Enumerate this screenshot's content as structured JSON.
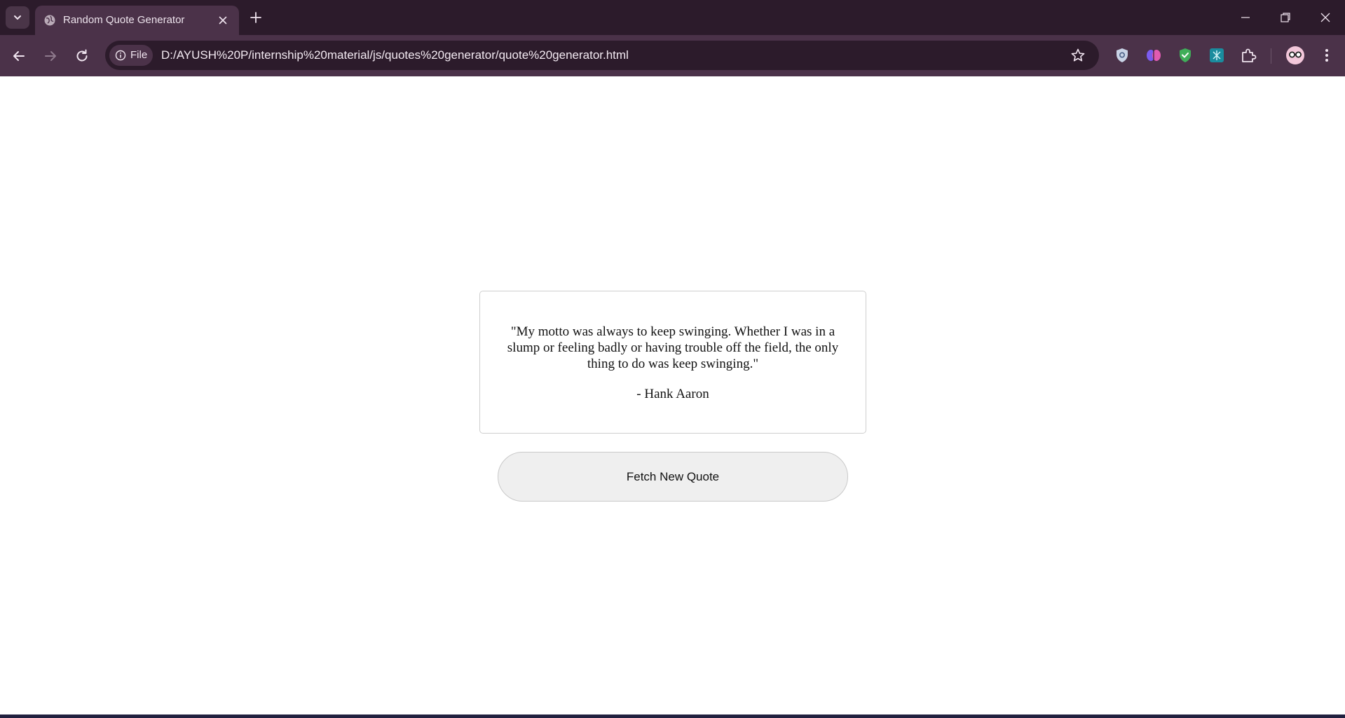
{
  "browser": {
    "tab_title": "Random Quote Generator",
    "site_chip_label": "File",
    "url": "D:/AYUSH%20P/internship%20material/js/quotes%20generator/quote%20generator.html",
    "accent_color": "#4b3249",
    "frame_color": "#2c1b2b"
  },
  "icons": {
    "tab_search": "chevron-down-icon",
    "favicon": "globe-icon",
    "close_tab": "close-icon",
    "new_tab": "plus-icon",
    "back": "back-arrow-icon",
    "forward": "forward-arrow-icon",
    "reload": "reload-icon",
    "site_info": "info-icon",
    "bookmark": "star-icon",
    "extensions": [
      "shield-extension-icon",
      "brain-extension-icon",
      "check-shield-extension-icon",
      "teal-extension-icon",
      "puzzle-icon"
    ],
    "profile": "avatar-icon",
    "menu": "kebab-menu-icon"
  },
  "quote": {
    "text": "\"My motto was always to keep swinging. Whether I was in a slump or feeling badly or having trouble off the field, the only thing to do was keep swinging.\"",
    "author": "- Hank Aaron"
  },
  "actions": {
    "fetch_label": "Fetch New Quote"
  }
}
